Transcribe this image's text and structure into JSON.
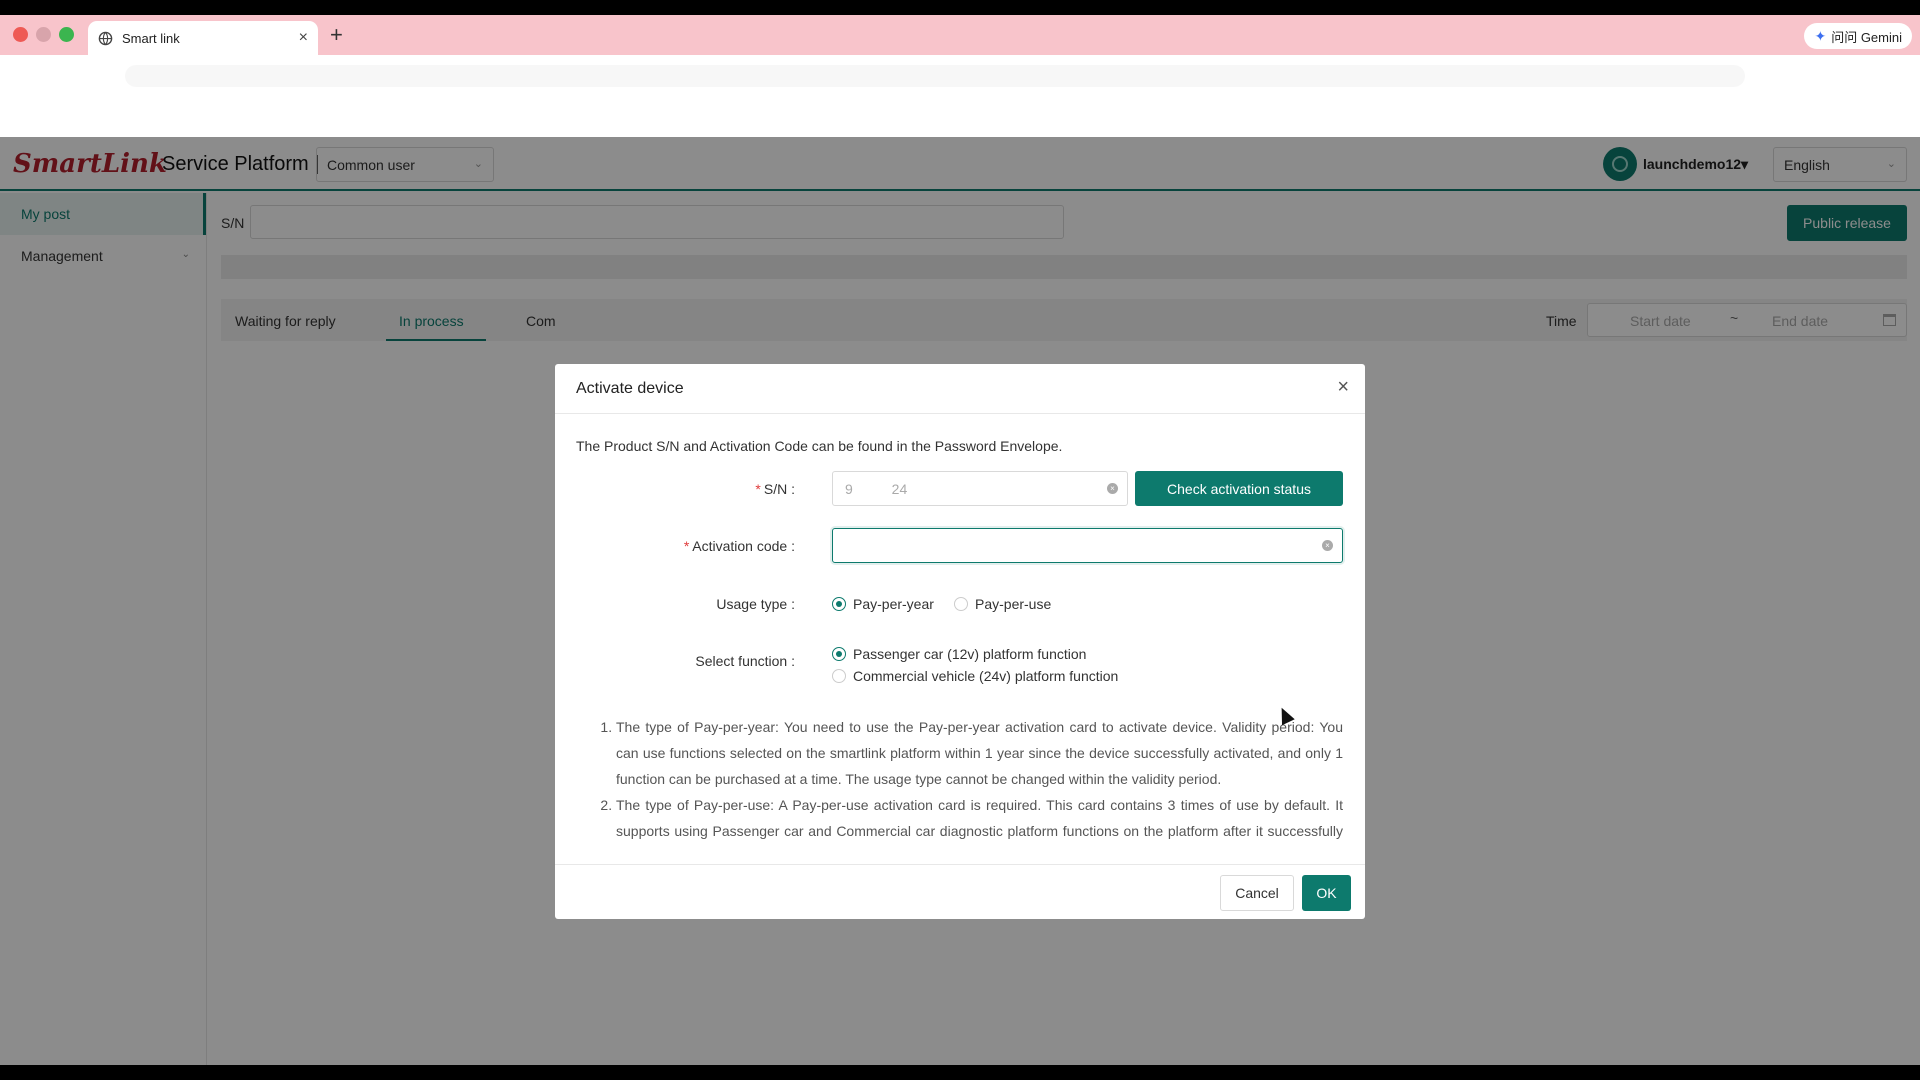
{
  "browser": {
    "tab_title": "Smart link",
    "tab_close": "×",
    "new_tab": "+",
    "gemini_label": "问问 Gemini"
  },
  "header": {
    "logo_text": "SmartLink",
    "platform_title": "Service Platform |",
    "role_select": "Common user",
    "username": "launchdemo12▾",
    "language": "English"
  },
  "sidebar": {
    "items": [
      {
        "label": "My post"
      },
      {
        "label": "Management"
      }
    ]
  },
  "main": {
    "sn_label": "S/N",
    "public_release": "Public release",
    "tabs": [
      {
        "label": "Waiting for reply"
      },
      {
        "label": "In process"
      },
      {
        "label": "Com"
      }
    ],
    "time_label": "Time",
    "start_date_placeholder": "Start date",
    "date_separator": "~",
    "end_date_placeholder": "End date"
  },
  "modal": {
    "title": "Activate device",
    "close": "×",
    "intro": "The Product S/N and Activation Code can be found in the Password Envelope.",
    "sn_label": "S/N",
    "sn_value": "9          24",
    "check_button": "Check activation status",
    "activation_label": "Activation code",
    "activation_value": "",
    "usage_label": "Usage type",
    "usage_options": [
      {
        "label": "Pay-per-year",
        "selected": true
      },
      {
        "label": "Pay-per-use",
        "selected": false
      }
    ],
    "function_label": "Select function",
    "function_options": [
      {
        "label": "Passenger car (12v) platform function",
        "selected": true
      },
      {
        "label": "Commercial vehicle (24v) platform function",
        "selected": false
      }
    ],
    "notes": [
      "The type of Pay-per-year: You need to use the Pay-per-year activation card to activate device. Validity period: You can use functions selected on the smartlink platform within 1 year since the device successfully activated, and only 1 function can be purchased at a time. The usage type cannot be changed within the validity period.",
      "The type of Pay-per-use: A Pay-per-use activation card is required. This card contains 3 times of use by default. It supports using Passenger car and Commercial car diagnostic platform functions on the platform after it successfully activated. The usage type can be changed within the validity period. The fee incurred by Pay-per-"
    ],
    "cancel": "Cancel",
    "ok": "OK"
  },
  "colors": {
    "accent": "#0d7a6d",
    "brand_red": "#b21f2d",
    "required": "#e03b3b",
    "chrome_tab_bar": "#f8c4cb"
  }
}
